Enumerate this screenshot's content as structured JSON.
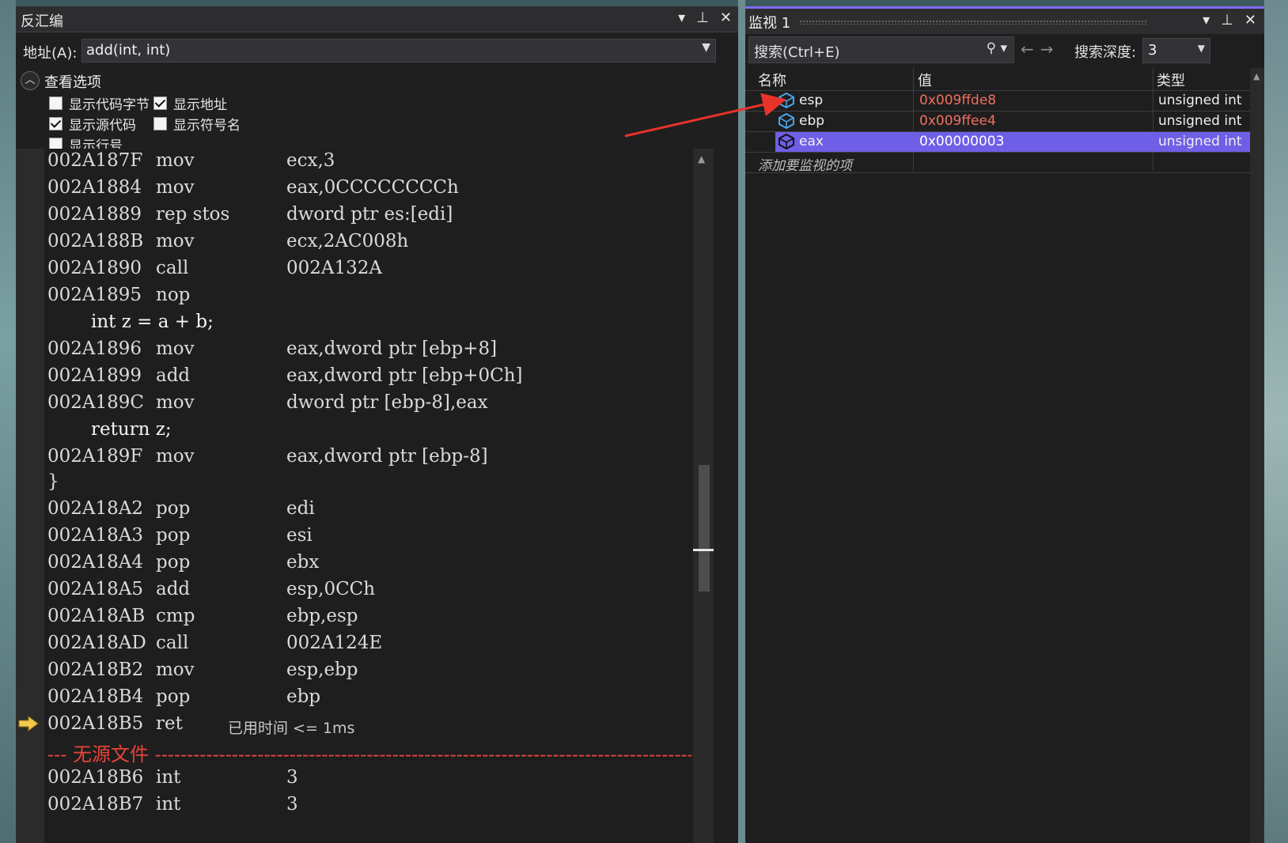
{
  "disasm": {
    "title": "反汇编",
    "address_label": "地址(A):",
    "address_value": "add(int, int)",
    "options_header": "查看选项",
    "options": [
      {
        "label": "显示代码字节",
        "checked": false
      },
      {
        "label": "显示地址",
        "checked": true
      },
      {
        "label": "显示源代码",
        "checked": true
      },
      {
        "label": "显示符号名",
        "checked": false
      },
      {
        "label": "显示行号",
        "checked": false
      }
    ],
    "lines": [
      {
        "addr": "002A187F",
        "mnem": "mov",
        "ops": "ecx,3"
      },
      {
        "addr": "002A1884",
        "mnem": "mov",
        "ops": "eax,0CCCCCCCCh"
      },
      {
        "addr": "002A1889",
        "mnem": "rep stos",
        "ops": "dword ptr es:[edi]"
      },
      {
        "addr": "002A188B",
        "mnem": "mov",
        "ops": "ecx,2AC008h"
      },
      {
        "addr": "002A1890",
        "mnem": "call",
        "ops": "002A132A"
      },
      {
        "addr": "002A1895",
        "mnem": "nop",
        "ops": ""
      },
      {
        "addr": "002A1896",
        "mnem": "mov",
        "ops": "eax,dword ptr [ebp+8]"
      },
      {
        "addr": "002A1899",
        "mnem": "add",
        "ops": "eax,dword ptr [ebp+0Ch]"
      },
      {
        "addr": "002A189C",
        "mnem": "mov",
        "ops": "dword ptr [ebp-8],eax"
      },
      {
        "addr": "002A189F",
        "mnem": "mov",
        "ops": "eax,dword ptr [ebp-8]"
      },
      {
        "addr": "002A18A2",
        "mnem": "pop",
        "ops": "edi"
      },
      {
        "addr": "002A18A3",
        "mnem": "pop",
        "ops": "esi"
      },
      {
        "addr": "002A18A4",
        "mnem": "pop",
        "ops": "ebx"
      },
      {
        "addr": "002A18A5",
        "mnem": "add",
        "ops": "esp,0CCh"
      },
      {
        "addr": "002A18AB",
        "mnem": "cmp",
        "ops": "ebp,esp"
      },
      {
        "addr": "002A18AD",
        "mnem": "call",
        "ops": "002A124E"
      },
      {
        "addr": "002A18B2",
        "mnem": "mov",
        "ops": "esp,ebp"
      },
      {
        "addr": "002A18B4",
        "mnem": "pop",
        "ops": "ebp"
      },
      {
        "addr": "002A18B5",
        "mnem": "ret",
        "ops": ""
      },
      {
        "addr": "002A18B6",
        "mnem": "int",
        "ops": "3"
      },
      {
        "addr": "002A18B7",
        "mnem": "int",
        "ops": "3"
      }
    ],
    "source_lines": [
      "int z = a + b;",
      "return z;"
    ],
    "brace": "}",
    "elapsed": "已用时间 <= 1ms",
    "no_source": "--- 无源文件 ---------------------------------------------------------------------------------------"
  },
  "watch": {
    "title": "监视 1",
    "search_placeholder": "搜索(Ctrl+E)",
    "search_depth_label": "搜索深度:",
    "search_depth_value": "3",
    "columns": {
      "name": "名称",
      "value": "值",
      "type": "类型"
    },
    "rows": [
      {
        "name": "esp",
        "value": "0x009ffde8",
        "type": "unsigned int",
        "selected": false
      },
      {
        "name": "ebp",
        "value": "0x009ffee4",
        "type": "unsigned int",
        "selected": false
      },
      {
        "name": "eax",
        "value": "0x00000003",
        "type": "unsigned int",
        "selected": true
      }
    ],
    "add_item": "添加要监视的项"
  },
  "colors": {
    "selection": "#6f5fe6",
    "changed_value": "#f07060",
    "no_source": "#e8443a",
    "annotation_arrow": "#e8322a"
  }
}
